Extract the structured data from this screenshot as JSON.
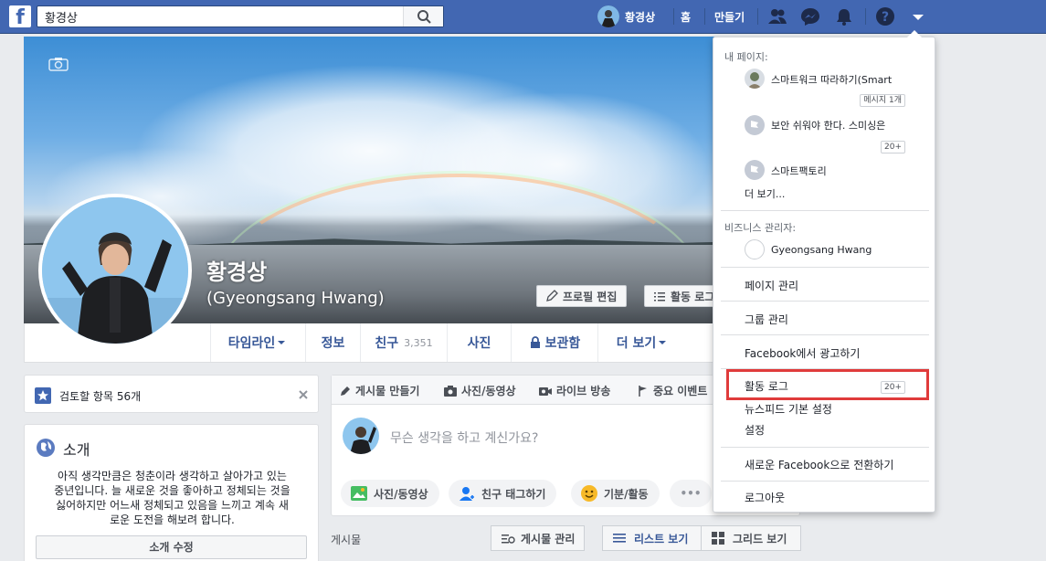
{
  "header": {
    "search_value": "황경상",
    "user_name": "황경상",
    "home": "홈",
    "create": "만들기"
  },
  "cover": {
    "name": "황경상",
    "alt_name": "(Gyeongsang Hwang)",
    "edit_profile": "프로필 편집",
    "activity_log_btn": "활동 로그"
  },
  "tabs": {
    "timeline": "타임라인",
    "about": "정보",
    "friends": "친구",
    "friends_count": "3,351",
    "photos": "사진",
    "archive": "보관함",
    "more": "더 보기"
  },
  "review": {
    "label": "검토할 항목 56개"
  },
  "intro": {
    "title": "소개",
    "bio_lines": [
      "아직 생각만큼은 청춘이라 생각하고 살아가고 있는",
      "중년입니다. 늘 새로운 것을 좋아하고 정체되는 것을",
      "싫어하지만 어느새 정체되고 있음을 느끼고 계속 새",
      "로운 도전을 해보려 합니다."
    ],
    "edit": "소개 수정"
  },
  "composer": {
    "tabs": [
      "게시물 만들기",
      "사진/동영상",
      "라이브 방송",
      "중요 이벤트"
    ],
    "placeholder": "무슨 생각을 하고 계신가요?",
    "actions": [
      "사진/동영상",
      "친구 태그하기",
      "기분/활동",
      "•••"
    ]
  },
  "posts": {
    "label": "게시물",
    "manage": "게시물 관리",
    "list_view": "리스트 보기",
    "grid_view": "그리드 보기"
  },
  "dropdown": {
    "my_pages_head": "내 페이지:",
    "pages": [
      {
        "name": "스마트워크 따라하기(Smart",
        "badge": "메시지 1개"
      },
      {
        "name": "보안 쉬워야 한다. 스미싱은",
        "badge": "20+"
      },
      {
        "name": "스마트팩토리",
        "badge": ""
      }
    ],
    "see_more": "더 보기...",
    "biz_head": "비즈니스 관리자:",
    "biz_name": "Gyeongsang Hwang",
    "manage_pages": "페이지 관리",
    "manage_groups": "그룹 관리",
    "advertise": "Facebook에서 광고하기",
    "activity_log": "활동 로그",
    "activity_badge": "20+",
    "newsfeed_pref": "뉴스피드 기본 설정",
    "settings": "설정",
    "switch": "새로운 Facebook으로 전환하기",
    "logout": "로그아웃"
  },
  "colors": {
    "brand": "#4267b2",
    "highlight": "#e03b3b"
  }
}
